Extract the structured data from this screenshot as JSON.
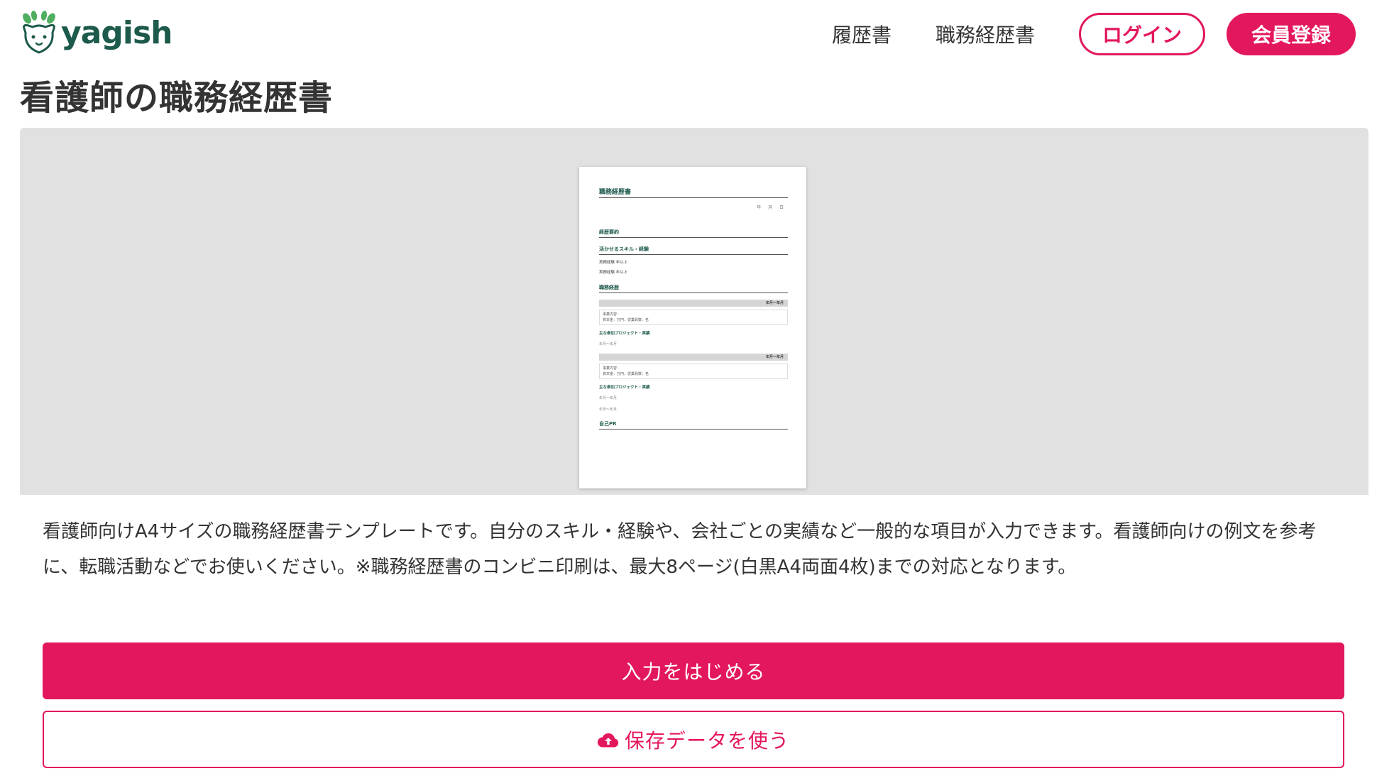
{
  "header": {
    "logo_text": "yagish",
    "nav": [
      "履歴書",
      "職務経歴書"
    ],
    "login_label": "ログイン",
    "register_label": "会員登録"
  },
  "page": {
    "title": "看護師の職務経歴書"
  },
  "preview": {
    "doc_title": "職務経歴書",
    "date": "年 月 日",
    "sections": {
      "summary": "経歴要約",
      "skills": "活かせるスキル・経験",
      "skill_line_1": "実務経験 年以上",
      "skill_line_2": "実務経験 年以上",
      "history": "職務経歴",
      "period_1": "年月～年月",
      "company_1": "事業内容：",
      "company_1b": "資本金：万円、従業員数：名",
      "project_1": "主な参加プロジェクト・実績",
      "project_1_item": "年月～年月",
      "period_2": "年月～年月",
      "company_2": "事業内容：",
      "company_2b": "資本金：万円、従業員数：名",
      "project_2": "主な参加プロジェクト・実績",
      "project_2_item_1": "年月～年月",
      "project_2_item_2": "年月～年月",
      "pr": "自己PR"
    }
  },
  "description": "看護師向けA4サイズの職務経歴書テンプレートです。自分のスキル・経験や、会社ごとの実績など一般的な項目が入力できます。看護師向けの例文を参考に、転職活動などでお使いください。※職務経歴書のコンビニ印刷は、最大8ページ(白黒A4両面4枚)までの対応となります。",
  "actions": {
    "start_label": "入力をはじめる",
    "saved_label": "保存データを使う"
  },
  "icons": {
    "logo": "goat-mascot-icon",
    "saved": "cloud-upload-icon"
  },
  "colors": {
    "accent": "#e3175d",
    "brand": "#1d5a4c",
    "preview_bg": "#e1e1e1"
  }
}
